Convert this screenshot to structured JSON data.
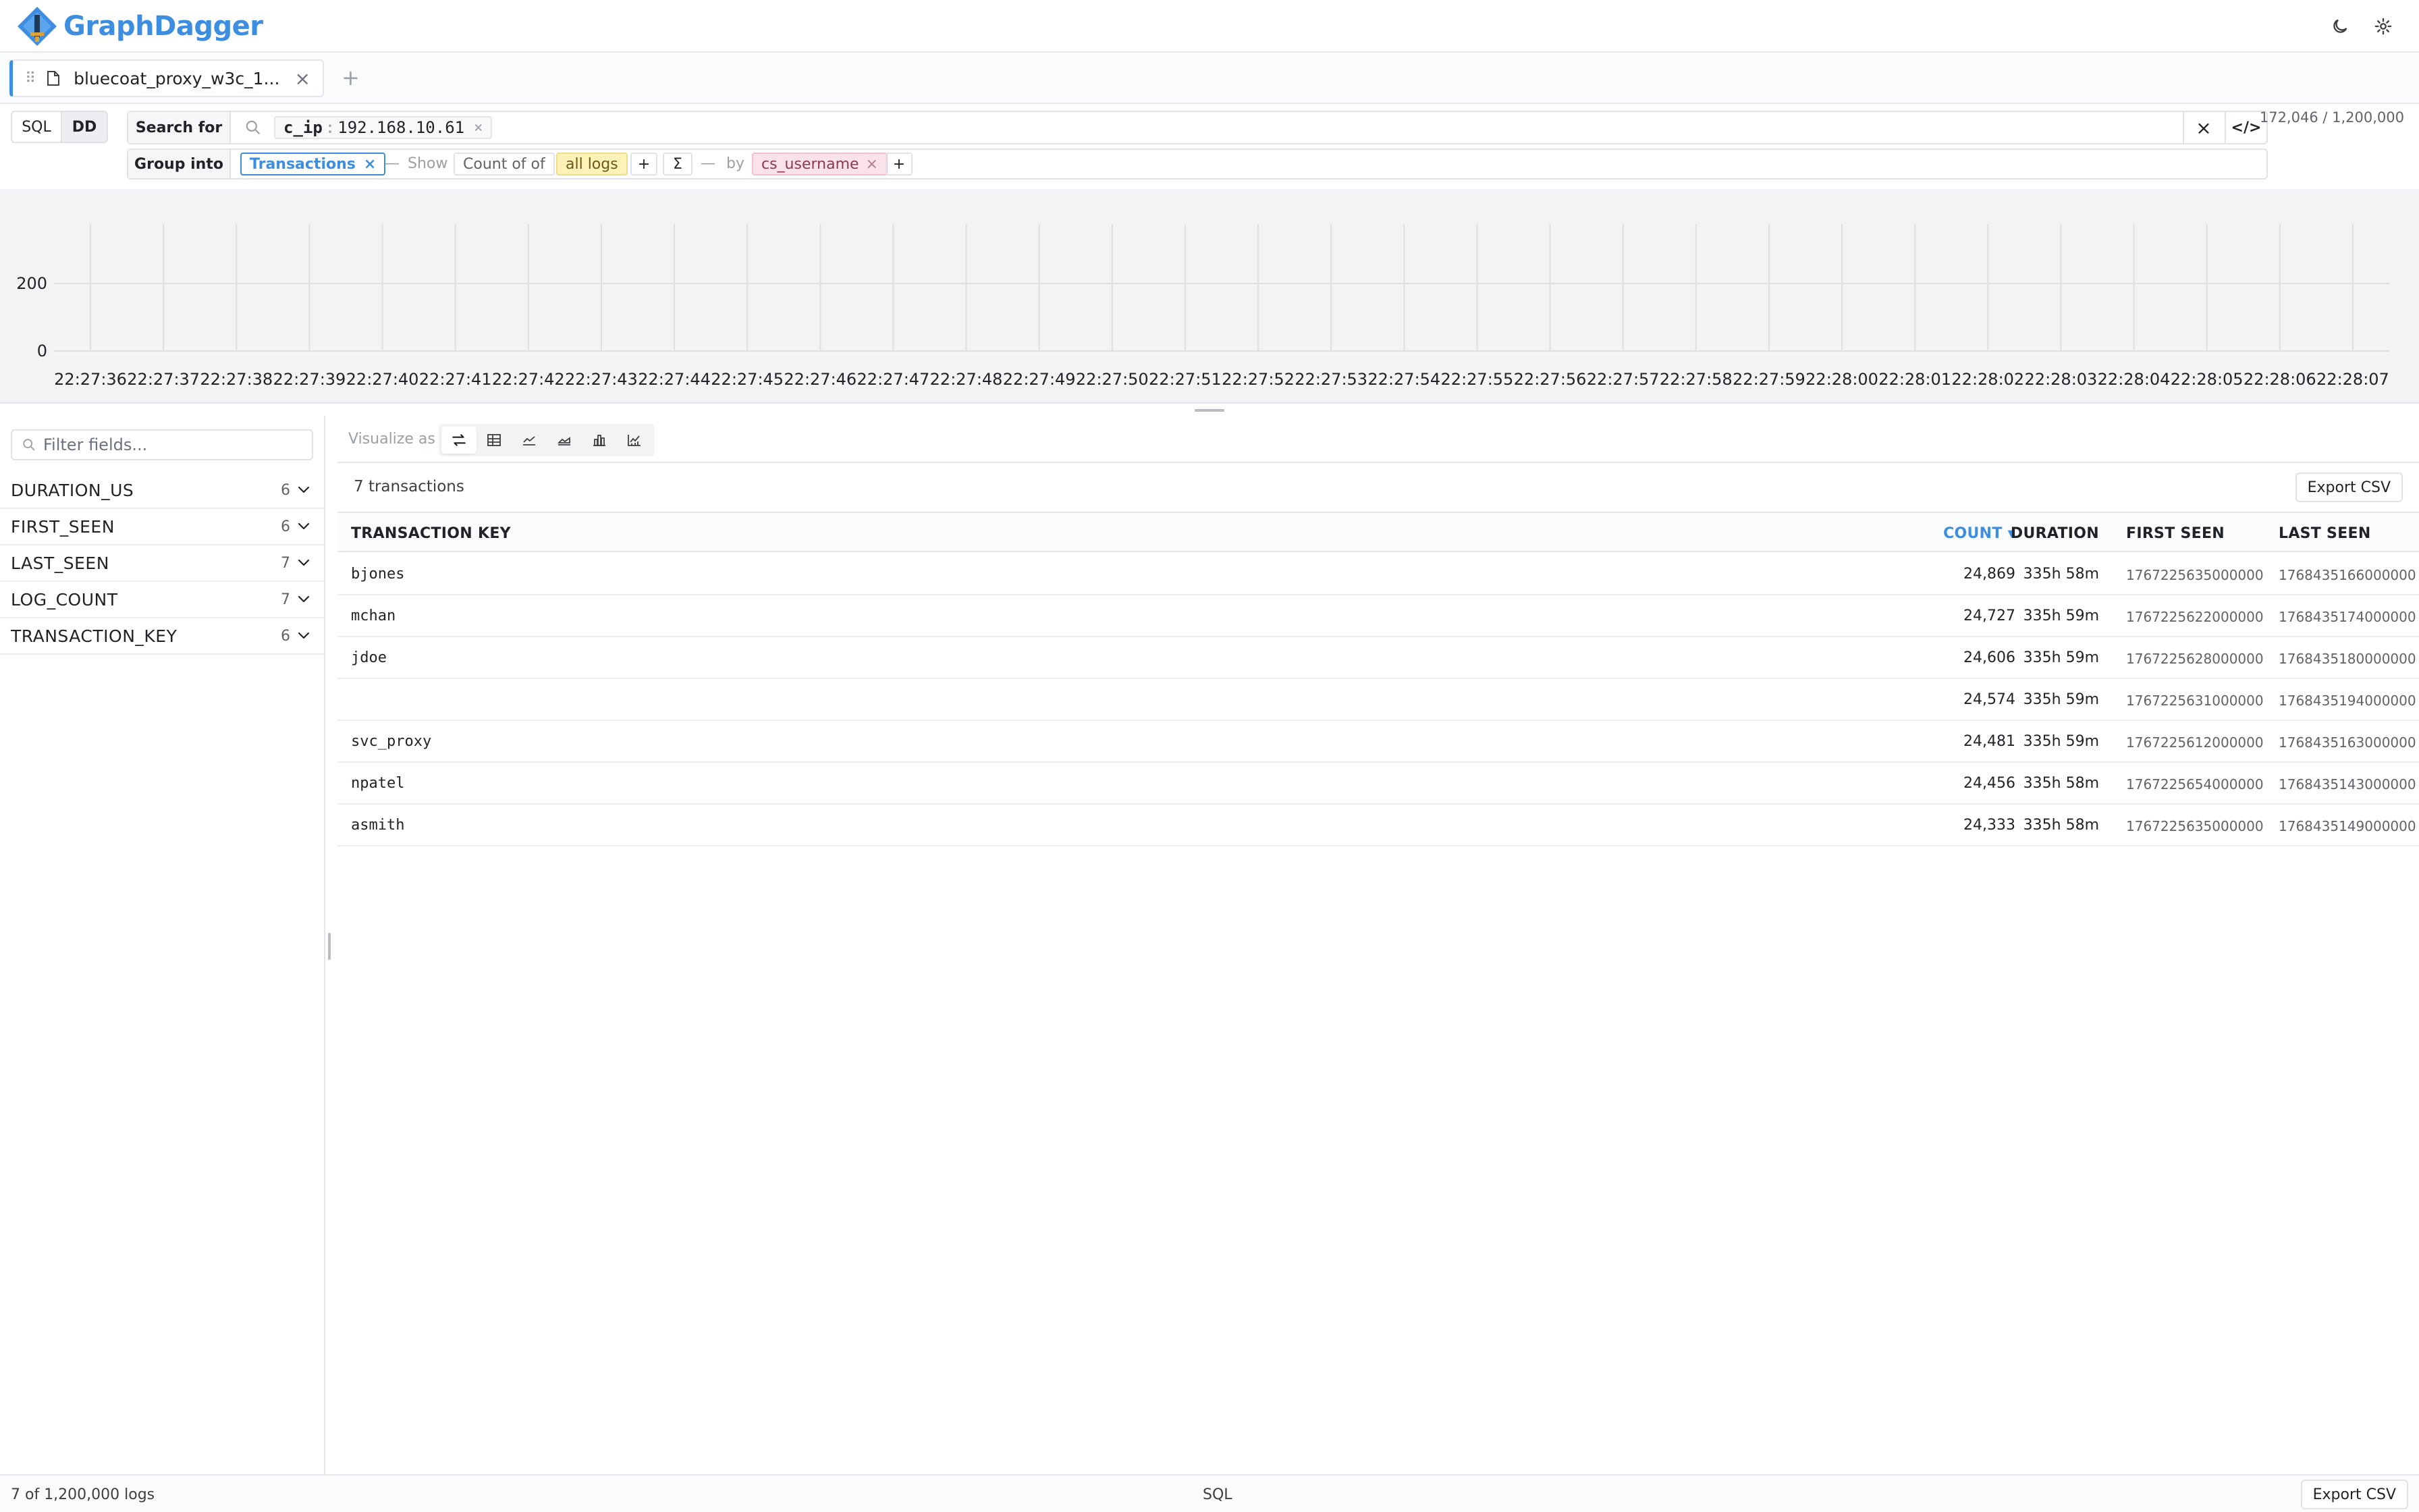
{
  "app": {
    "name": "GraphDagger"
  },
  "header": {
    "theme_icon": "moon-icon",
    "settings_icon": "gear-icon"
  },
  "tabs": [
    {
      "label": "bluecoat_proxy_w3c_1..."
    }
  ],
  "query": {
    "mode_sql": "SQL",
    "mode_dd": "DD",
    "search_label": "Search for",
    "filter_key": "c_ip",
    "filter_sep": ":",
    "filter_value": "192.168.10.61",
    "result_count": "172,046 / 1,200,000",
    "group_label": "Group into",
    "group_value": "Transactions",
    "dash": "—",
    "show_label": "Show",
    "count_of": "Count of of",
    "all_logs": "all logs",
    "add": "+",
    "sigma": "Σ",
    "by_label": "by",
    "by_value": "cs_username"
  },
  "chart_data": {
    "type": "bar",
    "categories": [
      "22:27:36",
      "22:27:37",
      "22:27:38",
      "22:27:39",
      "22:27:40",
      "22:27:41",
      "22:27:42",
      "22:27:43",
      "22:27:44",
      "22:27:45",
      "22:27:46",
      "22:27:47",
      "22:27:48",
      "22:27:49",
      "22:27:50",
      "22:27:51",
      "22:27:52",
      "22:27:53",
      "22:27:54",
      "22:27:55",
      "22:27:56",
      "22:27:57",
      "22:27:58",
      "22:27:59",
      "22:28:00",
      "22:28:01",
      "22:28:02",
      "22:28:03",
      "22:28:04",
      "22:28:05",
      "22:28:06",
      "22:28:07"
    ],
    "values": [],
    "yticks": [
      0,
      200
    ],
    "ylim": [
      0,
      400
    ],
    "grid": true
  },
  "sidebar": {
    "filter_placeholder": "Filter fields...",
    "fields": [
      {
        "name": "DURATION_US",
        "count": "6"
      },
      {
        "name": "FIRST_SEEN",
        "count": "6"
      },
      {
        "name": "LAST_SEEN",
        "count": "7"
      },
      {
        "name": "LOG_COUNT",
        "count": "7"
      },
      {
        "name": "TRANSACTION_KEY",
        "count": "6"
      }
    ]
  },
  "results": {
    "visualize_label": "Visualize as",
    "summary": "7 transactions",
    "export_label": "Export CSV",
    "columns": {
      "key": "TRANSACTION KEY",
      "count": "COUNT ▾",
      "duration": "DURATION",
      "first_seen": "FIRST SEEN",
      "last_seen": "LAST SEEN"
    },
    "accent_color": "#3d8ee0",
    "rows": [
      {
        "key": "bjones",
        "count": "24,869",
        "duration": "335h 58m",
        "first_seen": "1767225635000000",
        "last_seen": "1768435166000000"
      },
      {
        "key": "mchan",
        "count": "24,727",
        "duration": "335h 59m",
        "first_seen": "1767225622000000",
        "last_seen": "1768435174000000"
      },
      {
        "key": "jdoe",
        "count": "24,606",
        "duration": "335h 59m",
        "first_seen": "1767225628000000",
        "last_seen": "1768435180000000"
      },
      {
        "key": "",
        "count": "24,574",
        "duration": "335h 59m",
        "first_seen": "1767225631000000",
        "last_seen": "1768435194000000"
      },
      {
        "key": "svc_proxy",
        "count": "24,481",
        "duration": "335h 59m",
        "first_seen": "1767225612000000",
        "last_seen": "1768435163000000"
      },
      {
        "key": "npatel",
        "count": "24,456",
        "duration": "335h 58m",
        "first_seen": "1767225654000000",
        "last_seen": "1768435143000000"
      },
      {
        "key": "asmith",
        "count": "24,333",
        "duration": "335h 58m",
        "first_seen": "1767225635000000",
        "last_seen": "1768435149000000"
      }
    ]
  },
  "footer": {
    "status": "7 of 1,200,000 logs",
    "mode": "SQL",
    "export_label": "Export CSV"
  }
}
